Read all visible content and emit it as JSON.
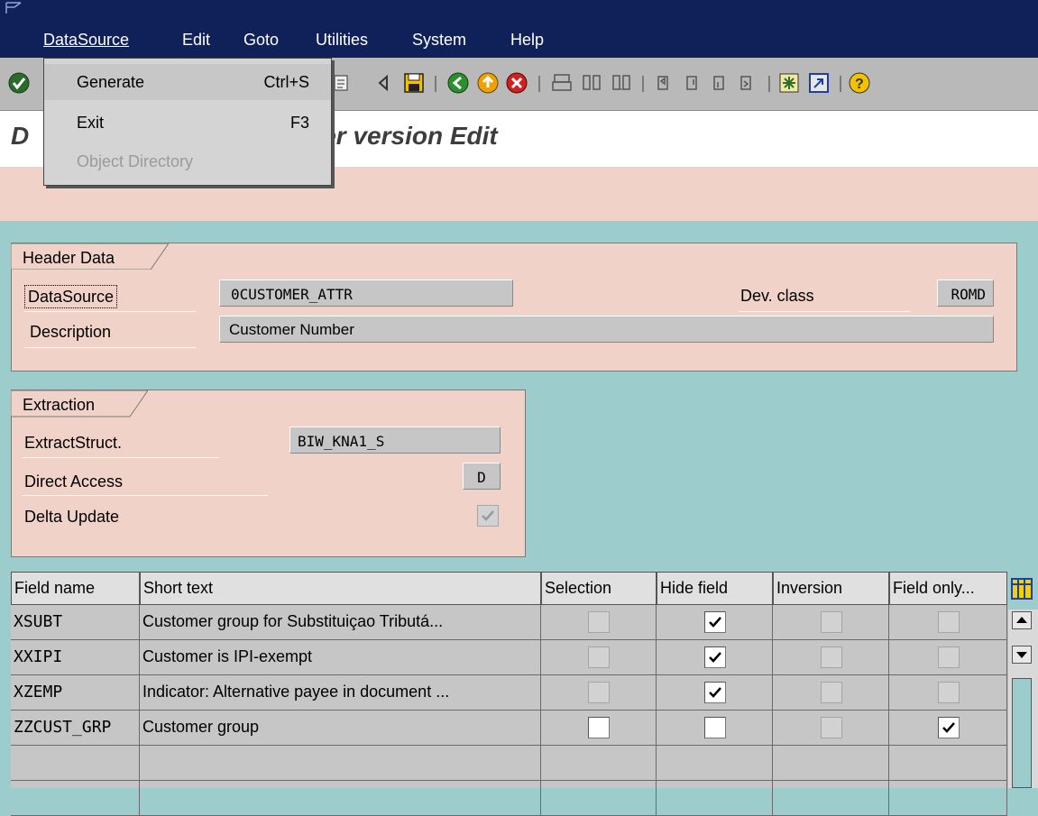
{
  "menubar": {
    "items": [
      "DataSource",
      "Edit",
      "Goto",
      "Utilities",
      "System",
      "Help"
    ]
  },
  "dropdown": {
    "items": [
      {
        "label": "Generate",
        "shortcut": "Ctrl+S",
        "state": "highlighted"
      },
      {
        "label": "Exit",
        "shortcut": "F3",
        "state": "enabled"
      },
      {
        "label": "Object Directory",
        "shortcut": "",
        "state": "disabled"
      }
    ]
  },
  "title": {
    "prefix": "D",
    "visible": "er version Edit"
  },
  "header": {
    "tab": "Header Data",
    "datasource_label": "DataSource",
    "datasource_value": "0CUSTOMER_ATTR",
    "devclass_label": "Dev. class",
    "devclass_value": "ROMD",
    "description_label": "Description",
    "description_value": "Customer Number"
  },
  "extraction": {
    "tab": "Extraction",
    "extractstruct_label": "ExtractStruct.",
    "extractstruct_value": "BIW_KNA1_S",
    "direct_label": "Direct Access",
    "direct_value": "D",
    "delta_label": "Delta Update",
    "delta_checked": true
  },
  "table": {
    "columns": [
      "Field name",
      "Short text",
      "Selection",
      "Hide field",
      "Inversion",
      "Field only..."
    ],
    "rows": [
      {
        "field": "XSUBT",
        "text": "Customer group for Substituiçao Tributá...",
        "selection": false,
        "selection_enabled": false,
        "hide": true,
        "hide_enabled": true,
        "inversion": false,
        "inversion_enabled": false,
        "fieldonly": false,
        "fieldonly_enabled": false
      },
      {
        "field": "XXIPI",
        "text": "Customer is IPI-exempt",
        "selection": false,
        "selection_enabled": false,
        "hide": true,
        "hide_enabled": true,
        "inversion": false,
        "inversion_enabled": false,
        "fieldonly": false,
        "fieldonly_enabled": false
      },
      {
        "field": "XZEMP",
        "text": "Indicator: Alternative payee in document ...",
        "selection": false,
        "selection_enabled": false,
        "hide": true,
        "hide_enabled": true,
        "inversion": false,
        "inversion_enabled": false,
        "fieldonly": false,
        "fieldonly_enabled": false
      },
      {
        "field": "ZZCUST_GRP",
        "text": "Customer group",
        "selection": false,
        "selection_enabled": true,
        "hide": false,
        "hide_enabled": true,
        "inversion": false,
        "inversion_enabled": false,
        "fieldonly": true,
        "fieldonly_enabled": true
      },
      {
        "field": "",
        "text": "",
        "empty": true
      },
      {
        "field": "",
        "text": "",
        "empty": true
      }
    ]
  },
  "colors": {
    "menubar": "#10215a",
    "panel": "#f0d2c8",
    "background": "#9ccccc"
  }
}
